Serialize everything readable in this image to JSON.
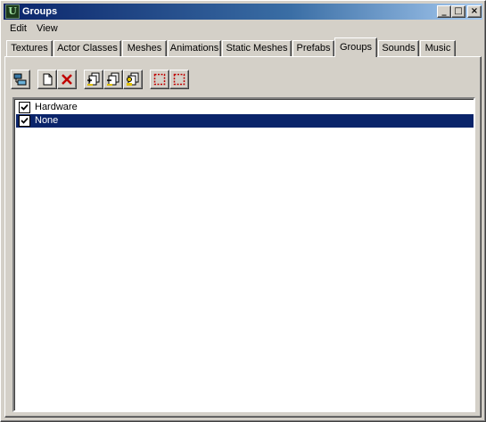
{
  "window": {
    "title": "Groups"
  },
  "title_buttons": {
    "minimize": "_",
    "maximize": "□",
    "close": "×"
  },
  "menu": [
    {
      "label": "Edit"
    },
    {
      "label": "View"
    }
  ],
  "tabs": [
    {
      "label": "Textures"
    },
    {
      "label": "Actor Classes"
    },
    {
      "label": "Meshes"
    },
    {
      "label": "Animations"
    },
    {
      "label": "Static Meshes"
    },
    {
      "label": "Prefabs"
    },
    {
      "label": "Groups",
      "active": true
    },
    {
      "label": "Sounds"
    },
    {
      "label": "Music"
    }
  ],
  "toolbar": {
    "buttons": [
      {
        "icon": "group-properties-icon"
      },
      {
        "icon": "new-group-icon"
      },
      {
        "icon": "delete-group-icon"
      },
      {
        "icon": "add-actors-icon"
      },
      {
        "icon": "remove-actors-icon"
      },
      {
        "icon": "select-actors-icon"
      },
      {
        "icon": "select-all-icon"
      },
      {
        "icon": "deselect-all-icon"
      }
    ]
  },
  "groups": [
    {
      "label": "Hardware",
      "checked": true,
      "selected": false
    },
    {
      "label": "None",
      "checked": true,
      "selected": true
    }
  ],
  "colors": {
    "selection": "#0a246a",
    "title_start": "#0a246a",
    "title_end": "#a6caf0",
    "face": "#d4d0c8"
  }
}
